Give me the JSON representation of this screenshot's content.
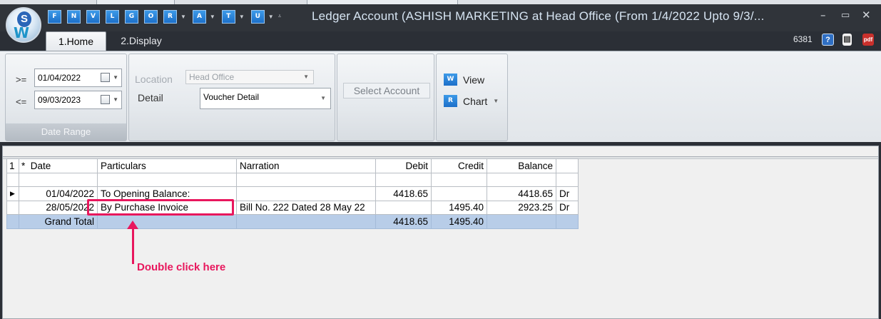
{
  "window": {
    "title": "Ledger Account (ASHISH MARKETING at Head Office  (From 1/4/2022 Upto 9/3/...",
    "quick_access": [
      "F",
      "N",
      "V",
      "L",
      "G",
      "O",
      "R",
      "A",
      "T",
      "U"
    ],
    "controls": {
      "minimize": "–",
      "maximize": "▭",
      "close": "✕"
    }
  },
  "tabs": [
    {
      "label": "1.Home",
      "active": true
    },
    {
      "label": "2.Display",
      "active": false
    }
  ],
  "top_right": {
    "count": "6381"
  },
  "ribbon": {
    "date_range": {
      "from_op": ">=",
      "from_date": "01/04/2022",
      "to_op": "<=",
      "to_date": "09/03/2023",
      "group_label": "Date Range"
    },
    "location": {
      "label": "Location",
      "value": "Head Office"
    },
    "detail": {
      "label": "Detail",
      "value": "Voucher Detail"
    },
    "select_account": "Select Account",
    "view_button": "View",
    "chart_button": "Chart",
    "view_icon": "W",
    "chart_icon": "R"
  },
  "grid": {
    "corner": "1",
    "star": "*",
    "columns": [
      "Date",
      "Particulars",
      "Narration",
      "Debit",
      "Credit",
      "Balance"
    ],
    "rows": [
      {
        "date": "01/04/2022",
        "particulars": "To Opening Balance:",
        "narration": "",
        "debit": "4418.65",
        "credit": "",
        "balance": "4418.65",
        "drcr": "Dr",
        "current": true
      },
      {
        "date": "28/05/2022",
        "particulars": "By Purchase Invoice",
        "narration": "Bill No. 222 Dated 28 May 22",
        "debit": "",
        "credit": "1495.40",
        "balance": "2923.25",
        "drcr": "Dr",
        "current": false
      }
    ],
    "total": {
      "label": "Grand Total",
      "debit": "4418.65",
      "credit": "1495.40"
    }
  },
  "annotation": {
    "text": "Double click here",
    "color": "#e8175d"
  }
}
